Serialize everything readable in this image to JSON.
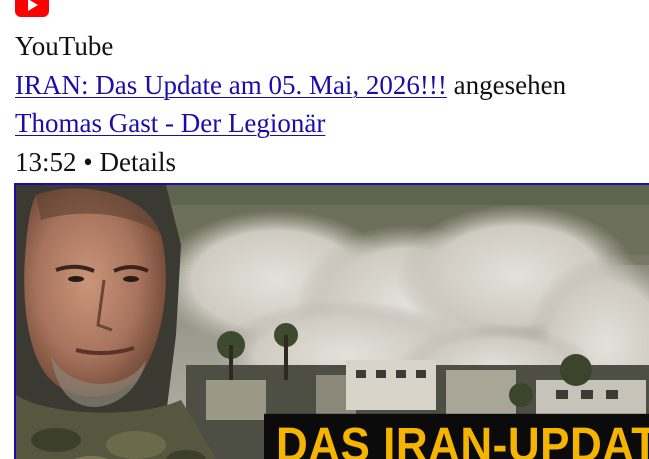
{
  "source": {
    "icon": "youtube-logo-icon",
    "name": "YouTube"
  },
  "activity": {
    "video_title": "IRAN: Das Update am 05. Mai, 2026!!!",
    "action": "angesehen",
    "channel": "Thomas Gast - Der Legionär",
    "duration": "13:52",
    "separator": "•",
    "details_label": "Details"
  },
  "thumbnail": {
    "overlay_text": "DAS IRAN-UPDATE",
    "overlay_text_color": "#f5b400",
    "border_color": "#1a0dab"
  },
  "colors": {
    "link": "#1a0dab",
    "brand_red": "#ff0000"
  }
}
